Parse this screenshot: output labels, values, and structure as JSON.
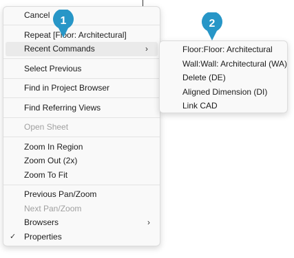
{
  "context_menu": {
    "items": [
      {
        "label": "Cancel"
      },
      {
        "label": "Repeat [Floor: Architectural]"
      },
      {
        "label": "Recent Commands",
        "has_submenu": true
      },
      {
        "label": "Select Previous"
      },
      {
        "label": "Find in Project Browser"
      },
      {
        "label": "Find Referring Views"
      },
      {
        "label": "Open Sheet",
        "disabled": true
      },
      {
        "label": "Zoom In Region"
      },
      {
        "label": "Zoom Out (2x)"
      },
      {
        "label": "Zoom To Fit"
      },
      {
        "label": "Previous Pan/Zoom"
      },
      {
        "label": "Next Pan/Zoom",
        "disabled": true
      },
      {
        "label": "Browsers",
        "has_submenu": true
      },
      {
        "label": "Properties",
        "checked": true
      }
    ]
  },
  "recent_commands_submenu": {
    "items": [
      {
        "label": "Floor:Floor: Architectural"
      },
      {
        "label": "Wall:Wall: Architectural (WA)"
      },
      {
        "label": "Delete (DE)"
      },
      {
        "label": "Aligned Dimension (DI)"
      },
      {
        "label": "Link CAD"
      }
    ]
  },
  "callouts": [
    {
      "number": "1",
      "color": "#2796c7"
    },
    {
      "number": "2",
      "color": "#2796c7"
    }
  ],
  "icons": {
    "submenu_arrow": "chevron-right-icon",
    "check": "checkmark-icon"
  }
}
